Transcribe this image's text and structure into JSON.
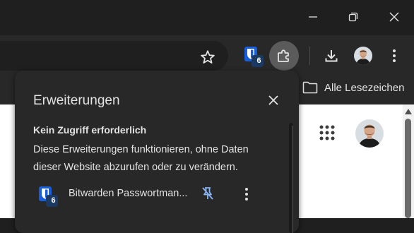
{
  "colors": {
    "accent_blue": "#3c8cf0",
    "bitwarden_blue": "#175ddc",
    "badge_bg": "#1b3a63",
    "pin_icon": "#8ab4f8"
  },
  "window_controls": {
    "minimize_icon": "minimize-icon",
    "restore_icon": "restore-icon",
    "close_icon": "close-icon"
  },
  "toolbar": {
    "bookmark_star_icon": "star-icon",
    "bitwarden_badge": "6",
    "extensions_icon": "puzzle-icon",
    "download_icon": "download-icon",
    "menu_icon": "more-vert-icon"
  },
  "bookmarks_bar": {
    "all_bookmarks_label": "Alle Lesezeichen"
  },
  "extensions_popup": {
    "title": "Erweiterungen",
    "section_heading": "Kein Zugriff erforderlich",
    "section_description": "Diese Erweiterungen funktionieren, ohne Daten dieser Website abzurufen oder zu verändern.",
    "items": [
      {
        "name": "Bitwarden Passwortman...",
        "badge": "6",
        "pin_icon": "unpin-icon",
        "more_icon": "more-vert-icon"
      }
    ]
  }
}
